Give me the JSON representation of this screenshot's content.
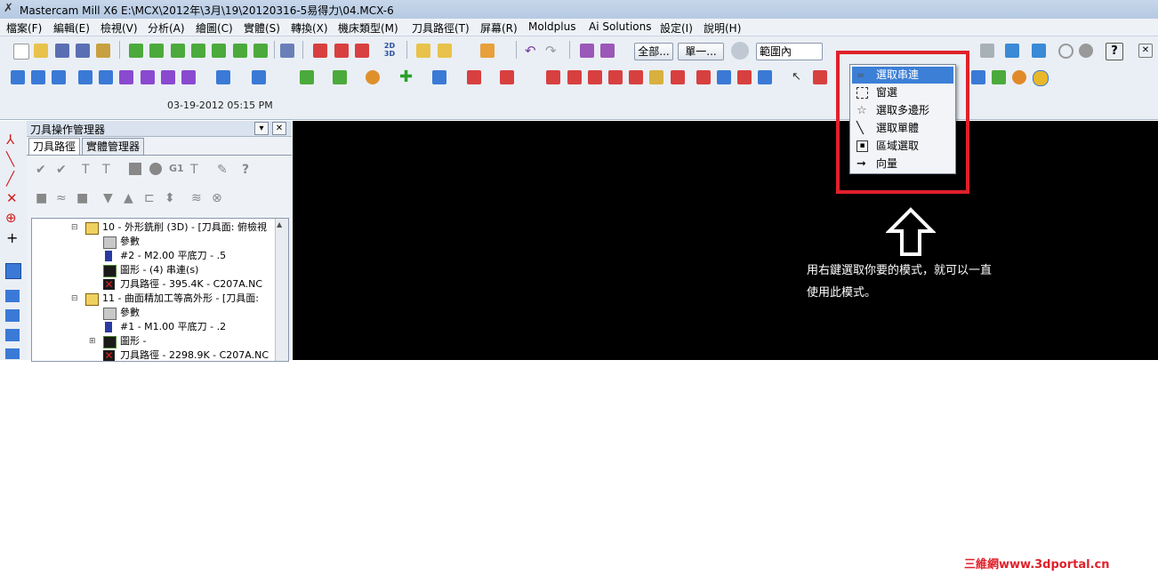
{
  "window": {
    "title": "Mastercam Mill X6  E:\\MCX\\2012年\\3月\\19\\20120316-5易得力\\04.MCX-6"
  },
  "menu": [
    "檔案(F)",
    "編輯(E)",
    "檢視(V)",
    "分析(A)",
    "繪圖(C)",
    "實體(S)",
    "轉換(X)",
    "機床類型(M)",
    "刀具路徑(T)",
    "屏幕(R)",
    "Moldplus",
    "Ai Solutions",
    "設定(I)",
    "說明(H)"
  ],
  "toolbar": {
    "btn_all": "全部...",
    "btn_single": "單一...",
    "range_select": "範圍內",
    "btn_2d3d": "2D 3D"
  },
  "status": {
    "timestamp": "03-19-2012 05:15 PM"
  },
  "op_manager": {
    "title": "刀具操作管理器",
    "tabs": [
      "刀具路徑",
      "實體管理器"
    ],
    "toolbar_row1": "G1",
    "tree": [
      {
        "label": "10 - 外形銑削 (3D) - [刀具面: 俯檢視",
        "icon": "folder-icon",
        "level": 0
      },
      {
        "label": "參數",
        "icon": "params-icon",
        "level": 1
      },
      {
        "label": "#2 - M2.00 平底刀 -      .5",
        "icon": "tool-icon",
        "level": 1
      },
      {
        "label": "圖形 - (4) 串連(s)",
        "icon": "geometry-icon",
        "level": 1
      },
      {
        "label": "刀具路徑 - 395.4K - C207A.NC",
        "icon": "toolpath-icon",
        "level": 1
      },
      {
        "label": "11 - 曲面精加工等高外形 - [刀具面:",
        "icon": "folder-icon",
        "level": 0
      },
      {
        "label": "參數",
        "icon": "params-icon",
        "level": 1
      },
      {
        "label": "#1 - M1.00 平底刀 -      .2",
        "icon": "tool-icon",
        "level": 1
      },
      {
        "label": "圖形 -",
        "icon": "geometry-icon",
        "level": 1
      },
      {
        "label": "刀具路徑 - 2298.9K - C207A.NC",
        "icon": "toolpath-icon",
        "level": 1
      }
    ]
  },
  "context_menu": {
    "items": [
      {
        "label": "選取串連",
        "icon": "chain-icon",
        "selected": true
      },
      {
        "label": "窗選",
        "icon": "window-icon",
        "selected": false
      },
      {
        "label": "選取多邊形",
        "icon": "polygon-icon",
        "selected": false
      },
      {
        "label": "選取單體",
        "icon": "single-icon",
        "selected": false
      },
      {
        "label": "區域選取",
        "icon": "area-icon",
        "selected": false
      },
      {
        "label": "向量",
        "icon": "vector-icon",
        "selected": false
      }
    ]
  },
  "annotation": {
    "line1": "用右鍵選取你要的模式，就可以一直",
    "line2": "使用此模式。"
  },
  "watermark": "三維網www.3dportal.cn",
  "colors": {
    "highlight": "#e0202a",
    "selection": "#3c7fd6",
    "viewport": "#000000"
  }
}
